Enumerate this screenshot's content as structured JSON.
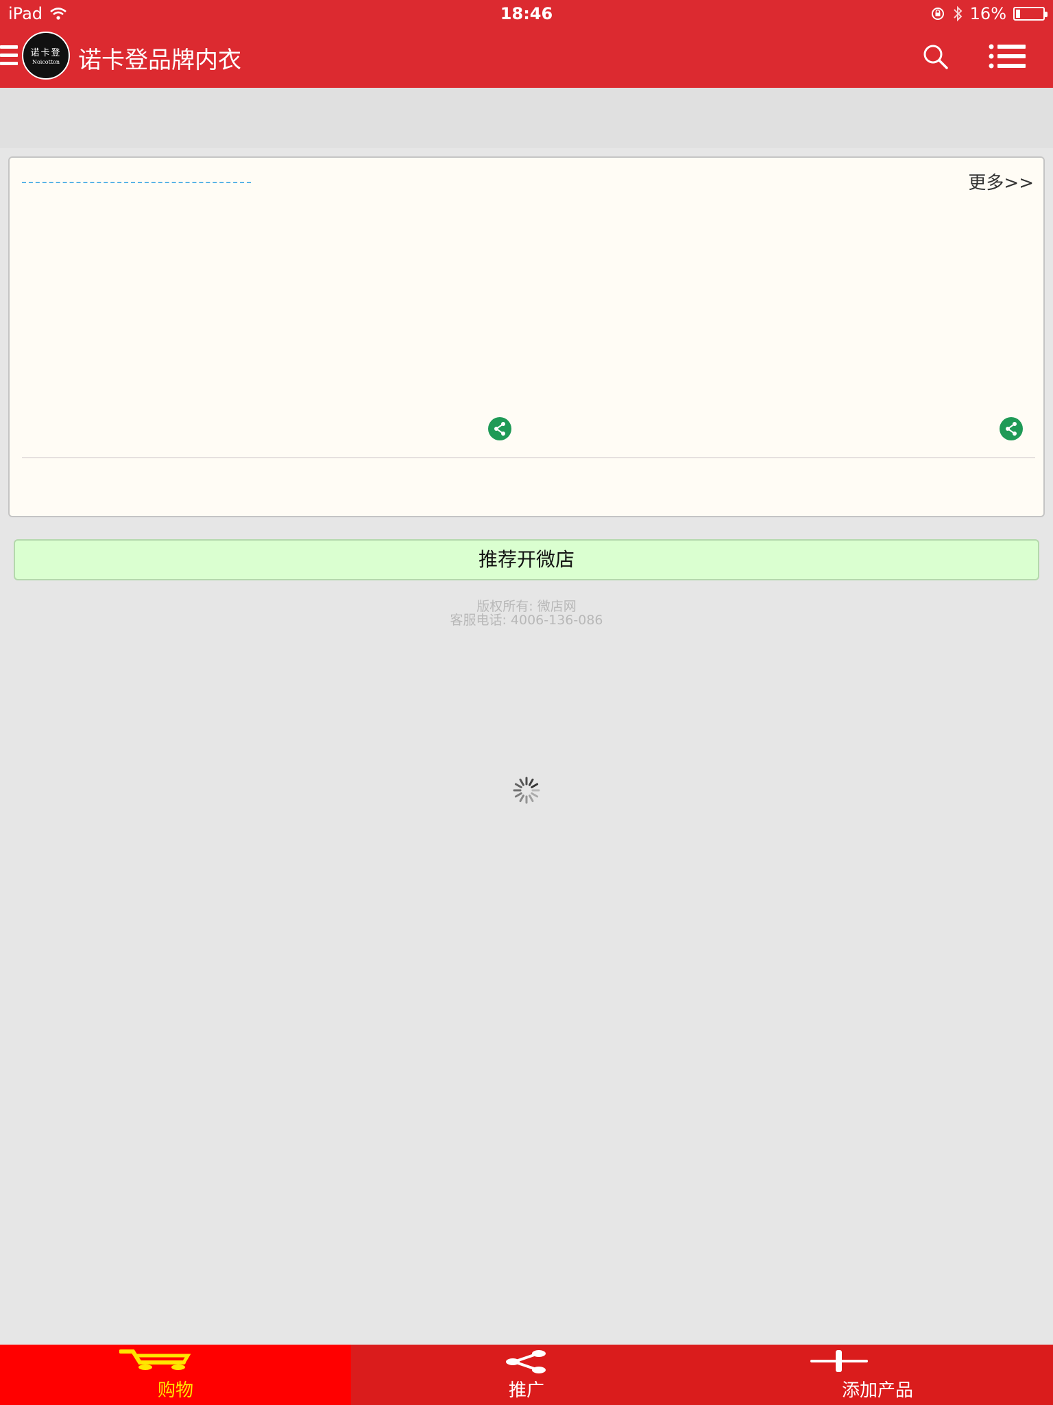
{
  "status_bar": {
    "device": "iPad",
    "time": "18:46",
    "battery": "16%",
    "battery_level": 0.16
  },
  "header": {
    "title": "诺卡登品牌内衣",
    "logo": {
      "cn_text": "诺卡登",
      "en_text": "Noicotton"
    }
  },
  "card": {
    "more_link": "更多>>"
  },
  "recommend_button": "推荐开微店",
  "footer": {
    "copyright": "版权所有: 微店网",
    "service_phone": "客服电话: 4006-136-086"
  },
  "tabbar": {
    "tabs": [
      {
        "label": "购物",
        "icon": "cart-icon",
        "active": true
      },
      {
        "label": "推广",
        "icon": "share-icon",
        "active": false
      },
      {
        "label": "添加产品",
        "icon": "plus-icon",
        "active": false
      }
    ]
  },
  "colors": {
    "header_red": "#dc2a30",
    "tab_active": "#ff0000",
    "tab_active_text": "#ffe600",
    "share_green": "#1f9a56",
    "recommend_bg": "#daffd0"
  }
}
